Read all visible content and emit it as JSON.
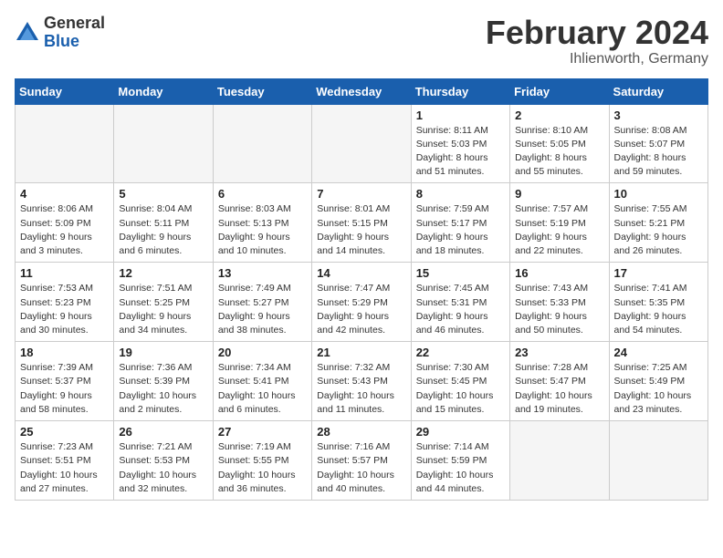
{
  "logo": {
    "general": "General",
    "blue": "Blue"
  },
  "title": "February 2024",
  "subtitle": "Ihlienworth, Germany",
  "days_of_week": [
    "Sunday",
    "Monday",
    "Tuesday",
    "Wednesday",
    "Thursday",
    "Friday",
    "Saturday"
  ],
  "weeks": [
    [
      {
        "day": "",
        "info": ""
      },
      {
        "day": "",
        "info": ""
      },
      {
        "day": "",
        "info": ""
      },
      {
        "day": "",
        "info": ""
      },
      {
        "day": "1",
        "info": "Sunrise: 8:11 AM\nSunset: 5:03 PM\nDaylight: 8 hours\nand 51 minutes."
      },
      {
        "day": "2",
        "info": "Sunrise: 8:10 AM\nSunset: 5:05 PM\nDaylight: 8 hours\nand 55 minutes."
      },
      {
        "day": "3",
        "info": "Sunrise: 8:08 AM\nSunset: 5:07 PM\nDaylight: 8 hours\nand 59 minutes."
      }
    ],
    [
      {
        "day": "4",
        "info": "Sunrise: 8:06 AM\nSunset: 5:09 PM\nDaylight: 9 hours\nand 3 minutes."
      },
      {
        "day": "5",
        "info": "Sunrise: 8:04 AM\nSunset: 5:11 PM\nDaylight: 9 hours\nand 6 minutes."
      },
      {
        "day": "6",
        "info": "Sunrise: 8:03 AM\nSunset: 5:13 PM\nDaylight: 9 hours\nand 10 minutes."
      },
      {
        "day": "7",
        "info": "Sunrise: 8:01 AM\nSunset: 5:15 PM\nDaylight: 9 hours\nand 14 minutes."
      },
      {
        "day": "8",
        "info": "Sunrise: 7:59 AM\nSunset: 5:17 PM\nDaylight: 9 hours\nand 18 minutes."
      },
      {
        "day": "9",
        "info": "Sunrise: 7:57 AM\nSunset: 5:19 PM\nDaylight: 9 hours\nand 22 minutes."
      },
      {
        "day": "10",
        "info": "Sunrise: 7:55 AM\nSunset: 5:21 PM\nDaylight: 9 hours\nand 26 minutes."
      }
    ],
    [
      {
        "day": "11",
        "info": "Sunrise: 7:53 AM\nSunset: 5:23 PM\nDaylight: 9 hours\nand 30 minutes."
      },
      {
        "day": "12",
        "info": "Sunrise: 7:51 AM\nSunset: 5:25 PM\nDaylight: 9 hours\nand 34 minutes."
      },
      {
        "day": "13",
        "info": "Sunrise: 7:49 AM\nSunset: 5:27 PM\nDaylight: 9 hours\nand 38 minutes."
      },
      {
        "day": "14",
        "info": "Sunrise: 7:47 AM\nSunset: 5:29 PM\nDaylight: 9 hours\nand 42 minutes."
      },
      {
        "day": "15",
        "info": "Sunrise: 7:45 AM\nSunset: 5:31 PM\nDaylight: 9 hours\nand 46 minutes."
      },
      {
        "day": "16",
        "info": "Sunrise: 7:43 AM\nSunset: 5:33 PM\nDaylight: 9 hours\nand 50 minutes."
      },
      {
        "day": "17",
        "info": "Sunrise: 7:41 AM\nSunset: 5:35 PM\nDaylight: 9 hours\nand 54 minutes."
      }
    ],
    [
      {
        "day": "18",
        "info": "Sunrise: 7:39 AM\nSunset: 5:37 PM\nDaylight: 9 hours\nand 58 minutes."
      },
      {
        "day": "19",
        "info": "Sunrise: 7:36 AM\nSunset: 5:39 PM\nDaylight: 10 hours\nand 2 minutes."
      },
      {
        "day": "20",
        "info": "Sunrise: 7:34 AM\nSunset: 5:41 PM\nDaylight: 10 hours\nand 6 minutes."
      },
      {
        "day": "21",
        "info": "Sunrise: 7:32 AM\nSunset: 5:43 PM\nDaylight: 10 hours\nand 11 minutes."
      },
      {
        "day": "22",
        "info": "Sunrise: 7:30 AM\nSunset: 5:45 PM\nDaylight: 10 hours\nand 15 minutes."
      },
      {
        "day": "23",
        "info": "Sunrise: 7:28 AM\nSunset: 5:47 PM\nDaylight: 10 hours\nand 19 minutes."
      },
      {
        "day": "24",
        "info": "Sunrise: 7:25 AM\nSunset: 5:49 PM\nDaylight: 10 hours\nand 23 minutes."
      }
    ],
    [
      {
        "day": "25",
        "info": "Sunrise: 7:23 AM\nSunset: 5:51 PM\nDaylight: 10 hours\nand 27 minutes."
      },
      {
        "day": "26",
        "info": "Sunrise: 7:21 AM\nSunset: 5:53 PM\nDaylight: 10 hours\nand 32 minutes."
      },
      {
        "day": "27",
        "info": "Sunrise: 7:19 AM\nSunset: 5:55 PM\nDaylight: 10 hours\nand 36 minutes."
      },
      {
        "day": "28",
        "info": "Sunrise: 7:16 AM\nSunset: 5:57 PM\nDaylight: 10 hours\nand 40 minutes."
      },
      {
        "day": "29",
        "info": "Sunrise: 7:14 AM\nSunset: 5:59 PM\nDaylight: 10 hours\nand 44 minutes."
      },
      {
        "day": "",
        "info": ""
      },
      {
        "day": "",
        "info": ""
      }
    ]
  ]
}
